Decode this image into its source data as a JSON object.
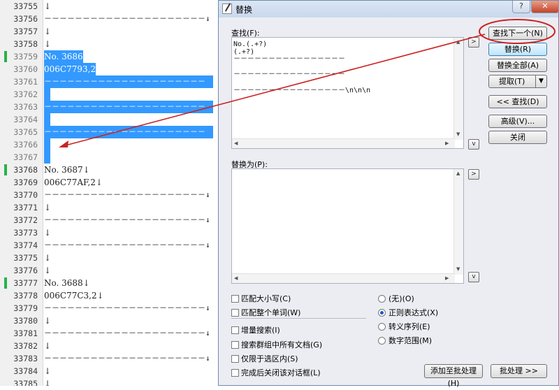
{
  "editor": {
    "lines": [
      {
        "num": "33755",
        "text": "↓",
        "type": "text",
        "sel": false,
        "mark": false
      },
      {
        "num": "33756",
        "text": "－－－－－－－－－－－－－－－－－－－－－↓",
        "type": "dash",
        "sel": false,
        "mark": false
      },
      {
        "num": "33757",
        "text": "↓",
        "type": "text",
        "sel": false,
        "mark": false
      },
      {
        "num": "33758",
        "text": "↓",
        "type": "text",
        "sel": false,
        "mark": false
      },
      {
        "num": "33759",
        "text": "No. 3686",
        "type": "text",
        "sel": true,
        "mark": true
      },
      {
        "num": "33760",
        "text": "006C7793,2",
        "type": "text",
        "sel": true,
        "mark": false
      },
      {
        "num": "33761",
        "text": "－－－－－－－－－－－－－－－－－－－－－",
        "type": "dash",
        "sel": true,
        "mark": false
      },
      {
        "num": "33762",
        "text": " ",
        "type": "text",
        "sel": true,
        "mark": false
      },
      {
        "num": "33763",
        "text": "－－－－－－－－－－－－－－－－－－－－－",
        "type": "dash",
        "sel": true,
        "mark": false
      },
      {
        "num": "33764",
        "text": " ",
        "type": "text",
        "sel": true,
        "mark": false
      },
      {
        "num": "33765",
        "text": "－－－－－－－－－－－－－－－－－－－－－",
        "type": "dash",
        "sel": true,
        "mark": false
      },
      {
        "num": "33766",
        "text": " ",
        "type": "text",
        "sel": true,
        "mark": false
      },
      {
        "num": "33767",
        "text": " ",
        "type": "text",
        "sel": true,
        "mark": false
      },
      {
        "num": "33768",
        "text": "No. 3687↓",
        "type": "text",
        "sel": false,
        "mark": true
      },
      {
        "num": "33769",
        "text": "006C77AF,2↓",
        "type": "text",
        "sel": false,
        "mark": false
      },
      {
        "num": "33770",
        "text": "－－－－－－－－－－－－－－－－－－－－－↓",
        "type": "dash",
        "sel": false,
        "mark": false
      },
      {
        "num": "33771",
        "text": "↓",
        "type": "text",
        "sel": false,
        "mark": false
      },
      {
        "num": "33772",
        "text": "－－－－－－－－－－－－－－－－－－－－－↓",
        "type": "dash",
        "sel": false,
        "mark": false
      },
      {
        "num": "33773",
        "text": "↓",
        "type": "text",
        "sel": false,
        "mark": false
      },
      {
        "num": "33774",
        "text": "－－－－－－－－－－－－－－－－－－－－－↓",
        "type": "dash",
        "sel": false,
        "mark": false
      },
      {
        "num": "33775",
        "text": "↓",
        "type": "text",
        "sel": false,
        "mark": false
      },
      {
        "num": "33776",
        "text": "↓",
        "type": "text",
        "sel": false,
        "mark": false
      },
      {
        "num": "33777",
        "text": "No. 3688↓",
        "type": "text",
        "sel": false,
        "mark": true
      },
      {
        "num": "33778",
        "text": "006C77C3,2↓",
        "type": "text",
        "sel": false,
        "mark": false
      },
      {
        "num": "33779",
        "text": "－－－－－－－－－－－－－－－－－－－－－↓",
        "type": "dash",
        "sel": false,
        "mark": false
      },
      {
        "num": "33780",
        "text": "↓",
        "type": "text",
        "sel": false,
        "mark": false
      },
      {
        "num": "33781",
        "text": "－－－－－－－－－－－－－－－－－－－－－↓",
        "type": "dash",
        "sel": false,
        "mark": false
      },
      {
        "num": "33782",
        "text": "↓",
        "type": "text",
        "sel": false,
        "mark": false
      },
      {
        "num": "33783",
        "text": "－－－－－－－－－－－－－－－－－－－－－↓",
        "type": "dash",
        "sel": false,
        "mark": false
      },
      {
        "num": "33784",
        "text": "↓",
        "type": "text",
        "sel": false,
        "mark": false
      },
      {
        "num": "33785",
        "text": "↓",
        "type": "text",
        "sel": false,
        "mark": false
      }
    ]
  },
  "dialog": {
    "title": "替换",
    "help_label": "?",
    "close_label": "✕",
    "find_label": "查找(F):",
    "find_lines": [
      "No.(.+?)",
      "(.+?)",
      "－－－－－－－－－－－－－－－－",
      "－－－－－－－－－－－－－－－－",
      "－－－－－－－－－－－－－－－－\\n\\n\\n"
    ],
    "replace_label": "替换为(P):",
    "replace_value": "",
    "find_arrow": ">",
    "find_history": "v",
    "replace_arrow": ">",
    "replace_history": "v",
    "buttons": {
      "find_next": "查找下一个(N)",
      "replace": "替换(R)",
      "replace_all": "替换全部(A)",
      "extract": "提取(T)",
      "find_prev": "<< 查找(D)",
      "advanced": "高级(V)...",
      "close": "关闭"
    },
    "checkboxes": [
      "匹配大小写(C)",
      "匹配整个单词(W)",
      "增量搜索(I)",
      "搜索群组中所有文档(G)",
      "仅限于选区内(S)",
      "完成后关闭该对话框(L)"
    ],
    "radios": [
      {
        "label": "(无)(O)",
        "checked": false
      },
      {
        "label": "正则表达式(X)",
        "checked": true
      },
      {
        "label": "转义序列(E)",
        "checked": false
      },
      {
        "label": "数字范围(M)",
        "checked": false
      }
    ],
    "add_batch": "添加至批处理(H)",
    "batch": "批处理 >>"
  },
  "colors": {
    "selection": "#3399ff",
    "annotation": "#cc2222",
    "line_marker": "#27b24a"
  }
}
